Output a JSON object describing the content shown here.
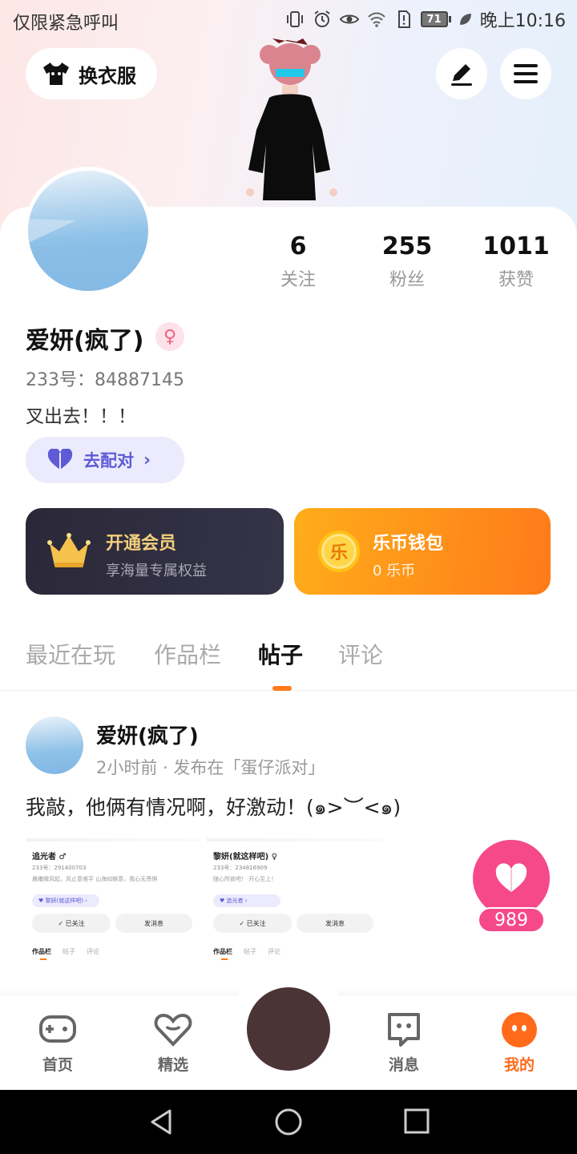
{
  "status_bar": {
    "left_text": "仅限紧急呼叫",
    "battery": "71",
    "time": "晚上10:16",
    "icons": [
      "vibrate-icon",
      "alarm-icon",
      "eye-icon",
      "wifi-icon",
      "sim-alert-icon",
      "battery-icon",
      "leaf-icon"
    ]
  },
  "header": {
    "outfit_label": "换衣服",
    "outfit_icon": "tshirt-icon",
    "edit_icon": "pen-icon",
    "menu_icon": "hamburger-icon"
  },
  "profile": {
    "name": "爱妍(疯了)",
    "gender_symbol": "♀",
    "uid": "233号：84887145",
    "bio": "叉出去！！！",
    "match_label": "去配对",
    "stats": [
      {
        "value": "6",
        "label": "关注"
      },
      {
        "value": "255",
        "label": "粉丝"
      },
      {
        "value": "1011",
        "label": "获赞"
      }
    ]
  },
  "cards": {
    "vip_title": "开通会员",
    "vip_subtitle": "享海量专属权益",
    "wallet_title": "乐币钱包",
    "wallet_subtitle": "0 乐币",
    "coin_glyph": "乐"
  },
  "tabs": [
    {
      "label": "最近在玩",
      "active": false
    },
    {
      "label": "作品栏",
      "active": false
    },
    {
      "label": "帖子",
      "active": true
    },
    {
      "label": "评论",
      "active": false
    }
  ],
  "post": {
    "author": "爱妍(疯了)",
    "meta": "2小时前 · 发布在「蛋仔派对」",
    "text": "我敲，他俩有情况啊，好激动！(๑>︶<๑)",
    "like_count": "989",
    "thumbs": [
      {
        "name": "追光者 ♂",
        "id": "233号：291400703",
        "desc": "晨曦微风起，风止意难平 山海如眼意，我心无畏惧",
        "pill": "♥ 黎妍(就这样吧) ›",
        "follow": "✓ 已关注",
        "message": "发消息",
        "mini_tabs": [
          "作品栏",
          "帖子",
          "评论"
        ]
      },
      {
        "name": "黎妍(就这样吧) ♀",
        "id": "233号：234816909",
        "desc": "随心所欲吧！ 开心至上！",
        "pill": "♥ 追光者 ›",
        "follow": "✓ 已关注",
        "message": "发消息",
        "mini_tabs": [
          "作品栏",
          "帖子",
          "评论"
        ]
      }
    ]
  },
  "bottom_nav": [
    {
      "label": "首页",
      "icon": "gamepad-icon",
      "active": false
    },
    {
      "label": "精选",
      "icon": "heart-chat-icon",
      "active": false
    },
    {
      "label": "消息",
      "icon": "message-face-icon",
      "active": false
    },
    {
      "label": "我的",
      "icon": "profile-face-icon",
      "active": true
    }
  ],
  "colors": {
    "accent": "#ff7a1a",
    "like": "#f5498a",
    "match": "#5d5bd6",
    "vip_gold": "#f3cf7c"
  }
}
